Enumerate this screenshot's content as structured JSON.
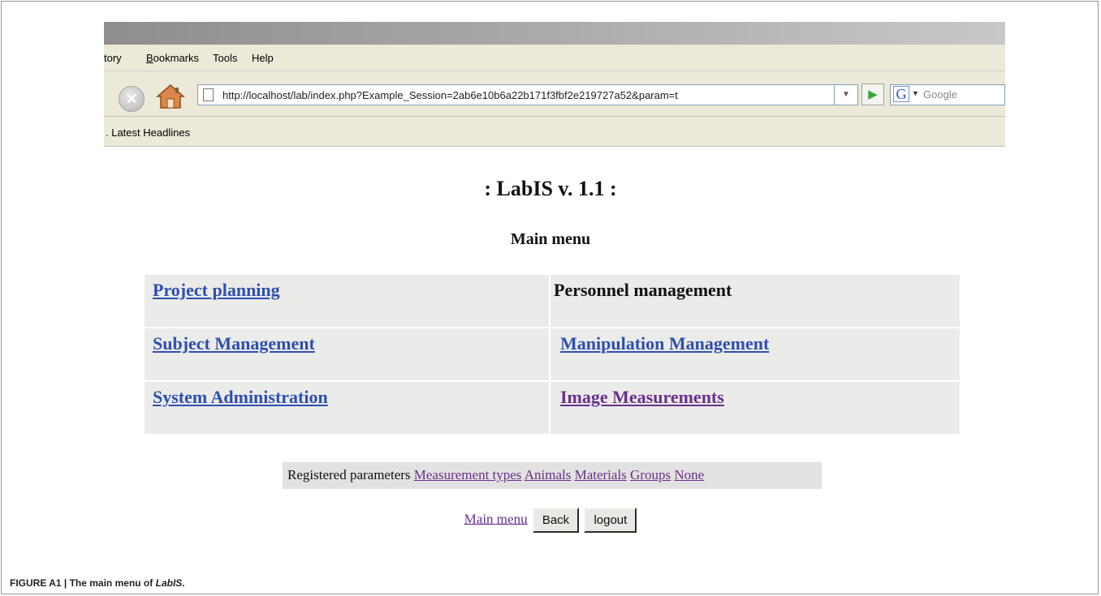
{
  "browser": {
    "menu": [
      "tory",
      "Bookmarks",
      "Tools",
      "Help"
    ],
    "url": "http://localhost/lab/index.php?Example_Session=2ab6e10b6a22b171f3fbf2e219727a52&param=t",
    "search_placeholder": "Google",
    "bookmarks_item": ". Latest Headlines"
  },
  "page": {
    "title": ": LabIS v. 1.1 :",
    "subtitle": "Main menu",
    "menu": [
      {
        "label": "Project planning"
      },
      {
        "label": "Personnel management"
      },
      {
        "label": "Subject Management"
      },
      {
        "label": "Manipulation Management"
      },
      {
        "label": "System Administration"
      },
      {
        "label": "Image Measurements"
      }
    ],
    "params_label": "Registered parameters",
    "params_links": [
      "Measurement types",
      "Animals",
      "Materials",
      "Groups",
      "None"
    ],
    "nav": {
      "main_menu": "Main menu",
      "back": "Back",
      "logout": "logout"
    }
  },
  "caption": {
    "prefix": "FIGURE A1 | The main menu of ",
    "name": "LabIS",
    "suffix": "."
  }
}
